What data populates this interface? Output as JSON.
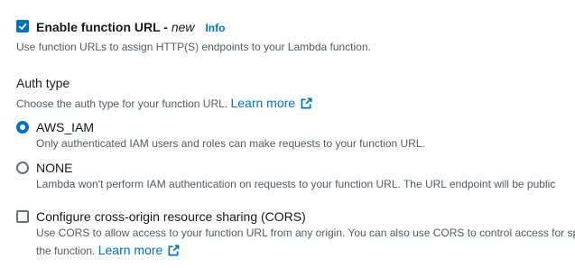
{
  "function_url": {
    "checked": true,
    "label": "Enable function URL - ",
    "label_badge": "new",
    "info_link": "Info",
    "description": "Use function URLs to assign HTTP(S) endpoints to your Lambda function."
  },
  "auth_type": {
    "heading": "Auth type",
    "description": "Choose the auth type for your function URL.",
    "learn_more": "Learn more",
    "options": [
      {
        "label": "AWS_IAM",
        "selected": true,
        "description": "Only authenticated IAM users and roles can make requests to your function URL."
      },
      {
        "label": "NONE",
        "selected": false,
        "description": "Lambda won't perform IAM authentication on requests to your function URL. The URL endpoint will be public"
      }
    ]
  },
  "cors": {
    "checked": false,
    "label": "Configure cross-origin resource sharing (CORS)",
    "description_line1": "Use CORS to allow access to your function URL from any origin. You can also use CORS to control access for sp",
    "description_line2": "the function.",
    "learn_more": "Learn more"
  },
  "colors": {
    "accent": "#0073bb",
    "text": "#16191f",
    "secondary_text": "#545b64"
  },
  "icons": {
    "checkbox_check": "checkmark-icon",
    "external_link": "external-link-icon"
  }
}
